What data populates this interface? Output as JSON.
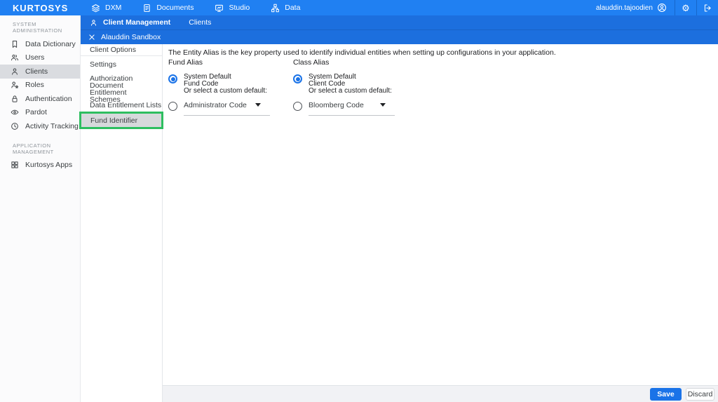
{
  "topbar": {
    "logo": "KURTOSYS",
    "nav": [
      {
        "label": "DXM",
        "icon": "layers-icon"
      },
      {
        "label": "Documents",
        "icon": "document-icon"
      },
      {
        "label": "Studio",
        "icon": "studio-icon"
      },
      {
        "label": "Data",
        "icon": "sitemap-icon"
      }
    ],
    "user": {
      "name": "alauddin.tajoodien"
    }
  },
  "breadcrumb_bar": {
    "section": "Client Management",
    "tab": "Clients"
  },
  "context_bar": {
    "title": "Alauddin Sandbox"
  },
  "sidebar": {
    "sections": [
      {
        "header": "SYSTEM ADMINISTRATION",
        "items": [
          {
            "label": "Data Dictionary",
            "icon": "bookmark-icon"
          },
          {
            "label": "Users",
            "icon": "users-icon"
          },
          {
            "label": "Clients",
            "icon": "person-icon",
            "selected": true
          },
          {
            "label": "Roles",
            "icon": "role-icon"
          },
          {
            "label": "Authentication",
            "icon": "lock-icon"
          },
          {
            "label": "Pardot",
            "icon": "eye-icon"
          },
          {
            "label": "Activity Tracking",
            "icon": "clock-icon"
          }
        ]
      },
      {
        "header": "APPLICATION MANAGEMENT",
        "items": [
          {
            "label": "Kurtosys Apps",
            "icon": "grid-icon"
          }
        ]
      }
    ]
  },
  "client_menu": {
    "header": "Client Options",
    "items": [
      "Settings",
      "Authorization",
      "Document Entitlement Schemes",
      "Data Entitlement Lists",
      "Fund Identifier"
    ],
    "selected": "Fund Identifier"
  },
  "main": {
    "description": "The Entity Alias is the key property used to identify individual entities when setting up configurations in your application.",
    "fund_alias": {
      "label": "Fund Alias",
      "system_option": {
        "line1": "System Default",
        "line2": "Fund Code",
        "line3": "Or select a custom default:"
      },
      "system_selected": true,
      "custom_value": "Administrator Code"
    },
    "class_alias": {
      "label": "Class Alias",
      "system_option": {
        "line1": "System Default",
        "line2": "Client Code",
        "line3": "Or select a custom default:"
      },
      "system_selected": true,
      "custom_value": "Bloomberg Code"
    }
  },
  "footer": {
    "save": "Save",
    "discard": "Discard"
  },
  "colors": {
    "topbar_blue": "#2080F2",
    "subbar_blue": "#1C6FDE",
    "accent_blue": "#1A73E8",
    "highlight_green": "#2EBE60",
    "selected_gray": "#DADCE0",
    "footer_gray": "#F1F2F5"
  }
}
